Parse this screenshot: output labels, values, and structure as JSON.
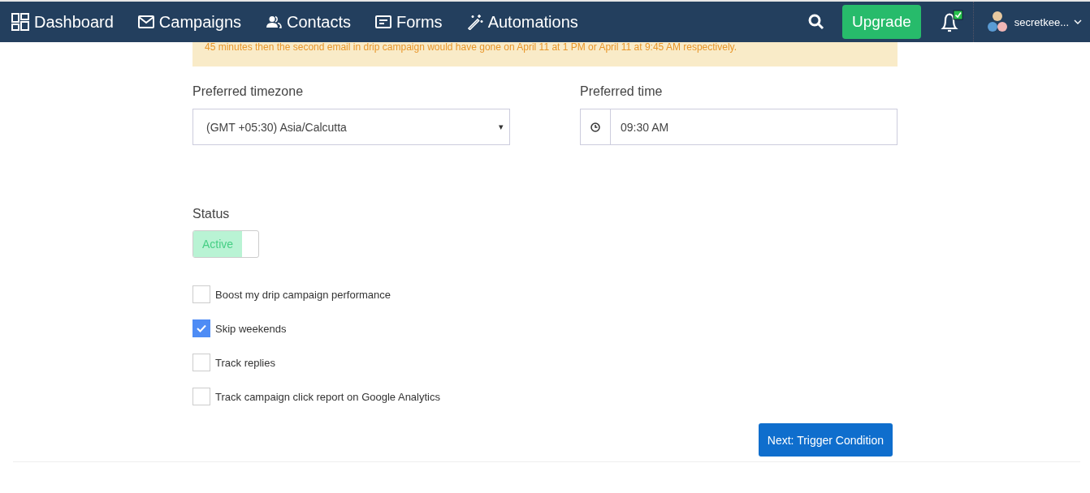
{
  "nav": {
    "items": [
      {
        "label": "Dashboard",
        "kind": "dashboard"
      },
      {
        "label": "Campaigns",
        "kind": "mail"
      },
      {
        "label": "Contacts",
        "kind": "people"
      },
      {
        "label": "Forms",
        "kind": "form"
      },
      {
        "label": "Automations",
        "kind": "wand"
      }
    ],
    "upgrade": "Upgrade",
    "notification_checked": true,
    "user": "secretkee..."
  },
  "alert": "45 minutes then the second email in drip campaign would have gone on April 11 at 1 PM or April 11 at 9:45 AM respectively.",
  "timezone": {
    "label": "Preferred timezone",
    "value": "(GMT +05:30) Asia/Calcutta",
    "caret": "▾"
  },
  "time": {
    "label": "Preferred time",
    "value": "09:30 AM"
  },
  "status": {
    "label": "Status",
    "on": true,
    "text": "Active"
  },
  "options": [
    {
      "label": "Boost my drip campaign performance",
      "checked": false
    },
    {
      "label": "Skip weekends",
      "checked": true
    },
    {
      "label": "Track replies",
      "checked": false
    },
    {
      "label": "Track campaign click report on Google Analytics",
      "checked": false
    }
  ],
  "next_button": "Next: Trigger Condition"
}
